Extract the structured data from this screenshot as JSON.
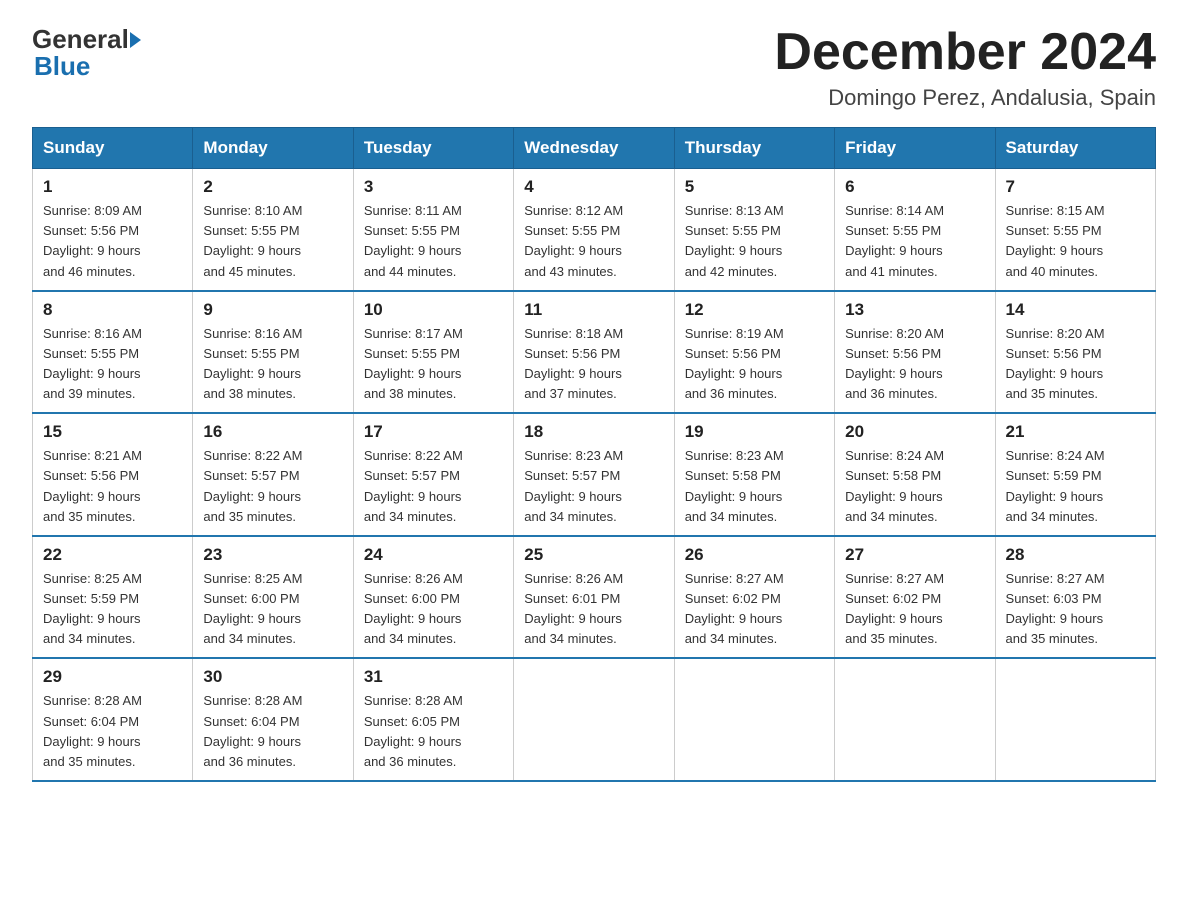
{
  "header": {
    "title": "December 2024",
    "subtitle": "Domingo Perez, Andalusia, Spain",
    "logo_general": "General",
    "logo_blue": "Blue"
  },
  "days_of_week": [
    "Sunday",
    "Monday",
    "Tuesday",
    "Wednesday",
    "Thursday",
    "Friday",
    "Saturday"
  ],
  "weeks": [
    [
      {
        "num": "1",
        "sunrise": "8:09 AM",
        "sunset": "5:56 PM",
        "daylight": "9 hours and 46 minutes."
      },
      {
        "num": "2",
        "sunrise": "8:10 AM",
        "sunset": "5:55 PM",
        "daylight": "9 hours and 45 minutes."
      },
      {
        "num": "3",
        "sunrise": "8:11 AM",
        "sunset": "5:55 PM",
        "daylight": "9 hours and 44 minutes."
      },
      {
        "num": "4",
        "sunrise": "8:12 AM",
        "sunset": "5:55 PM",
        "daylight": "9 hours and 43 minutes."
      },
      {
        "num": "5",
        "sunrise": "8:13 AM",
        "sunset": "5:55 PM",
        "daylight": "9 hours and 42 minutes."
      },
      {
        "num": "6",
        "sunrise": "8:14 AM",
        "sunset": "5:55 PM",
        "daylight": "9 hours and 41 minutes."
      },
      {
        "num": "7",
        "sunrise": "8:15 AM",
        "sunset": "5:55 PM",
        "daylight": "9 hours and 40 minutes."
      }
    ],
    [
      {
        "num": "8",
        "sunrise": "8:16 AM",
        "sunset": "5:55 PM",
        "daylight": "9 hours and 39 minutes."
      },
      {
        "num": "9",
        "sunrise": "8:16 AM",
        "sunset": "5:55 PM",
        "daylight": "9 hours and 38 minutes."
      },
      {
        "num": "10",
        "sunrise": "8:17 AM",
        "sunset": "5:55 PM",
        "daylight": "9 hours and 38 minutes."
      },
      {
        "num": "11",
        "sunrise": "8:18 AM",
        "sunset": "5:56 PM",
        "daylight": "9 hours and 37 minutes."
      },
      {
        "num": "12",
        "sunrise": "8:19 AM",
        "sunset": "5:56 PM",
        "daylight": "9 hours and 36 minutes."
      },
      {
        "num": "13",
        "sunrise": "8:20 AM",
        "sunset": "5:56 PM",
        "daylight": "9 hours and 36 minutes."
      },
      {
        "num": "14",
        "sunrise": "8:20 AM",
        "sunset": "5:56 PM",
        "daylight": "9 hours and 35 minutes."
      }
    ],
    [
      {
        "num": "15",
        "sunrise": "8:21 AM",
        "sunset": "5:56 PM",
        "daylight": "9 hours and 35 minutes."
      },
      {
        "num": "16",
        "sunrise": "8:22 AM",
        "sunset": "5:57 PM",
        "daylight": "9 hours and 35 minutes."
      },
      {
        "num": "17",
        "sunrise": "8:22 AM",
        "sunset": "5:57 PM",
        "daylight": "9 hours and 34 minutes."
      },
      {
        "num": "18",
        "sunrise": "8:23 AM",
        "sunset": "5:57 PM",
        "daylight": "9 hours and 34 minutes."
      },
      {
        "num": "19",
        "sunrise": "8:23 AM",
        "sunset": "5:58 PM",
        "daylight": "9 hours and 34 minutes."
      },
      {
        "num": "20",
        "sunrise": "8:24 AM",
        "sunset": "5:58 PM",
        "daylight": "9 hours and 34 minutes."
      },
      {
        "num": "21",
        "sunrise": "8:24 AM",
        "sunset": "5:59 PM",
        "daylight": "9 hours and 34 minutes."
      }
    ],
    [
      {
        "num": "22",
        "sunrise": "8:25 AM",
        "sunset": "5:59 PM",
        "daylight": "9 hours and 34 minutes."
      },
      {
        "num": "23",
        "sunrise": "8:25 AM",
        "sunset": "6:00 PM",
        "daylight": "9 hours and 34 minutes."
      },
      {
        "num": "24",
        "sunrise": "8:26 AM",
        "sunset": "6:00 PM",
        "daylight": "9 hours and 34 minutes."
      },
      {
        "num": "25",
        "sunrise": "8:26 AM",
        "sunset": "6:01 PM",
        "daylight": "9 hours and 34 minutes."
      },
      {
        "num": "26",
        "sunrise": "8:27 AM",
        "sunset": "6:02 PM",
        "daylight": "9 hours and 34 minutes."
      },
      {
        "num": "27",
        "sunrise": "8:27 AM",
        "sunset": "6:02 PM",
        "daylight": "9 hours and 35 minutes."
      },
      {
        "num": "28",
        "sunrise": "8:27 AM",
        "sunset": "6:03 PM",
        "daylight": "9 hours and 35 minutes."
      }
    ],
    [
      {
        "num": "29",
        "sunrise": "8:28 AM",
        "sunset": "6:04 PM",
        "daylight": "9 hours and 35 minutes."
      },
      {
        "num": "30",
        "sunrise": "8:28 AM",
        "sunset": "6:04 PM",
        "daylight": "9 hours and 36 minutes."
      },
      {
        "num": "31",
        "sunrise": "8:28 AM",
        "sunset": "6:05 PM",
        "daylight": "9 hours and 36 minutes."
      },
      null,
      null,
      null,
      null
    ]
  ],
  "labels": {
    "sunrise": "Sunrise:",
    "sunset": "Sunset:",
    "daylight": "Daylight:"
  }
}
